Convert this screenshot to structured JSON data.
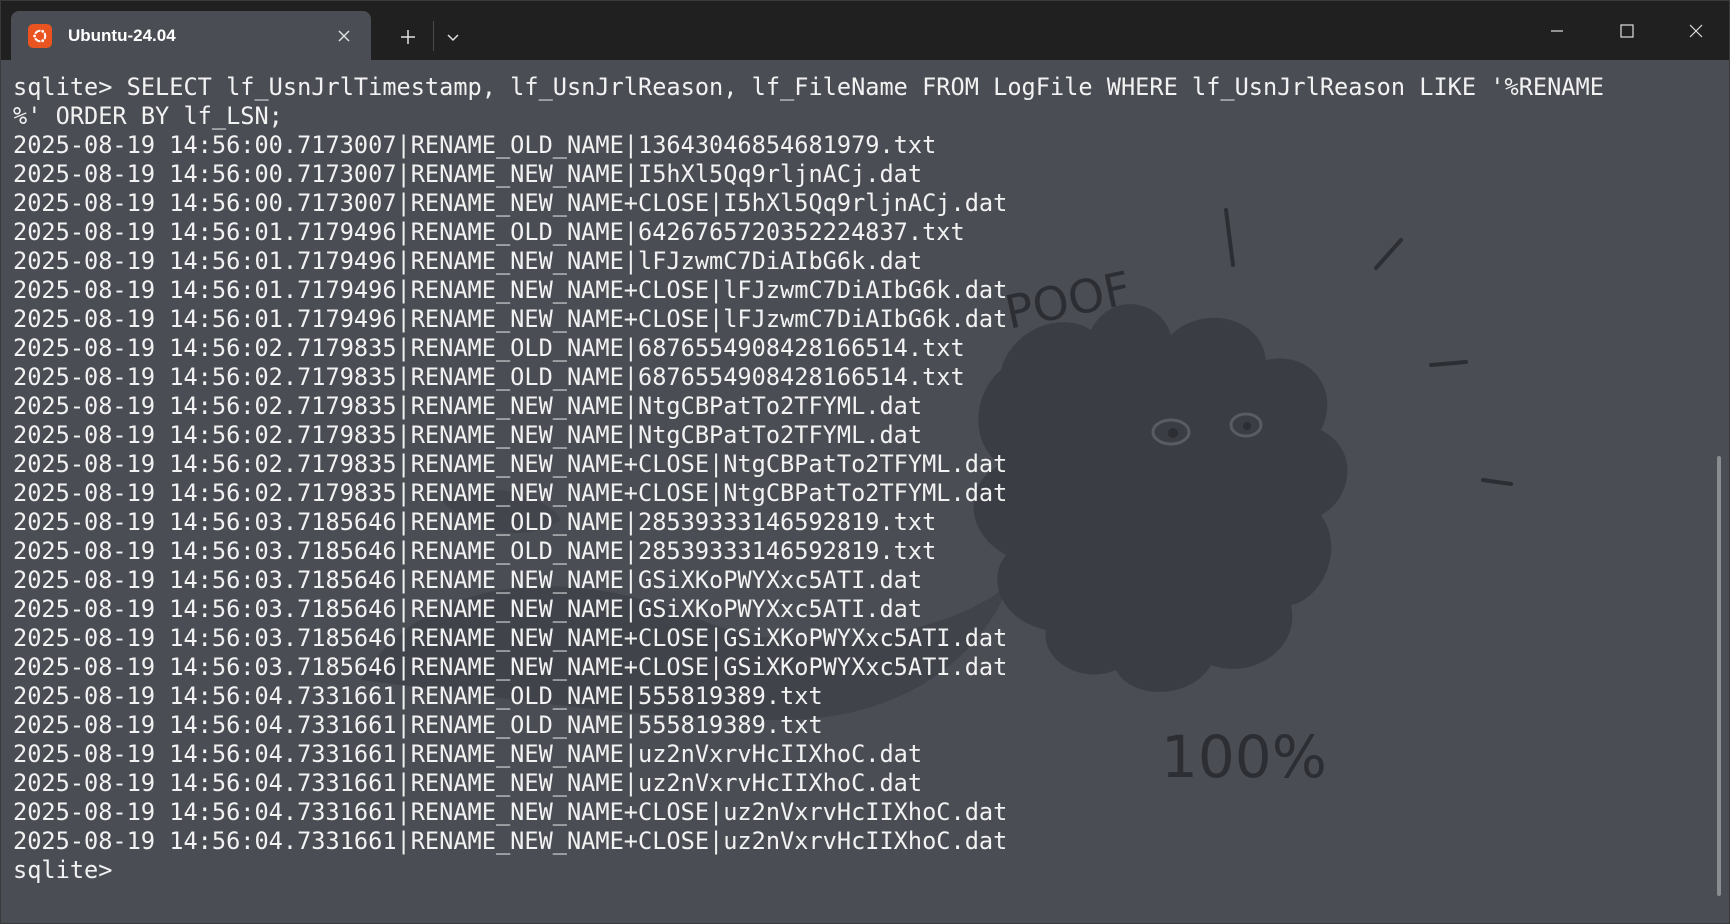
{
  "tab": {
    "title": "Ubuntu-24.04",
    "icon": "ubuntu-logo-icon",
    "accent": "#e95420"
  },
  "background_art": {
    "texts": [
      "POOF",
      "100%"
    ]
  },
  "terminal": {
    "lines": [
      "sqlite> SELECT lf_UsnJrlTimestamp, lf_UsnJrlReason, lf_FileName FROM LogFile WHERE lf_UsnJrlReason LIKE '%RENAME",
      "%' ORDER BY lf_LSN;",
      "2025-08-19 14:56:00.7173007|RENAME_OLD_NAME|13643046854681979.txt",
      "2025-08-19 14:56:00.7173007|RENAME_NEW_NAME|I5hXl5Qq9rljnACj.dat",
      "2025-08-19 14:56:00.7173007|RENAME_NEW_NAME+CLOSE|I5hXl5Qq9rljnACj.dat",
      "2025-08-19 14:56:01.7179496|RENAME_OLD_NAME|6426765720352224837.txt",
      "2025-08-19 14:56:01.7179496|RENAME_NEW_NAME|lFJzwmC7DiAIbG6k.dat",
      "2025-08-19 14:56:01.7179496|RENAME_NEW_NAME+CLOSE|lFJzwmC7DiAIbG6k.dat",
      "2025-08-19 14:56:01.7179496|RENAME_NEW_NAME+CLOSE|lFJzwmC7DiAIbG6k.dat",
      "2025-08-19 14:56:02.7179835|RENAME_OLD_NAME|6876554908428166514.txt",
      "2025-08-19 14:56:02.7179835|RENAME_OLD_NAME|6876554908428166514.txt",
      "2025-08-19 14:56:02.7179835|RENAME_NEW_NAME|NtgCBPatTo2TFYML.dat",
      "2025-08-19 14:56:02.7179835|RENAME_NEW_NAME|NtgCBPatTo2TFYML.dat",
      "2025-08-19 14:56:02.7179835|RENAME_NEW_NAME+CLOSE|NtgCBPatTo2TFYML.dat",
      "2025-08-19 14:56:02.7179835|RENAME_NEW_NAME+CLOSE|NtgCBPatTo2TFYML.dat",
      "2025-08-19 14:56:03.7185646|RENAME_OLD_NAME|28539333146592819.txt",
      "2025-08-19 14:56:03.7185646|RENAME_OLD_NAME|28539333146592819.txt",
      "2025-08-19 14:56:03.7185646|RENAME_NEW_NAME|GSiXKoPWYXxc5ATI.dat",
      "2025-08-19 14:56:03.7185646|RENAME_NEW_NAME|GSiXKoPWYXxc5ATI.dat",
      "2025-08-19 14:56:03.7185646|RENAME_NEW_NAME+CLOSE|GSiXKoPWYXxc5ATI.dat",
      "2025-08-19 14:56:03.7185646|RENAME_NEW_NAME+CLOSE|GSiXKoPWYXxc5ATI.dat",
      "2025-08-19 14:56:04.7331661|RENAME_OLD_NAME|555819389.txt",
      "2025-08-19 14:56:04.7331661|RENAME_OLD_NAME|555819389.txt",
      "2025-08-19 14:56:04.7331661|RENAME_NEW_NAME|uz2nVxrvHcIIXhoC.dat",
      "2025-08-19 14:56:04.7331661|RENAME_NEW_NAME|uz2nVxrvHcIIXhoC.dat",
      "2025-08-19 14:56:04.7331661|RENAME_NEW_NAME+CLOSE|uz2nVxrvHcIIXhoC.dat",
      "2025-08-19 14:56:04.7331661|RENAME_NEW_NAME+CLOSE|uz2nVxrvHcIIXhoC.dat",
      "sqlite> "
    ]
  }
}
